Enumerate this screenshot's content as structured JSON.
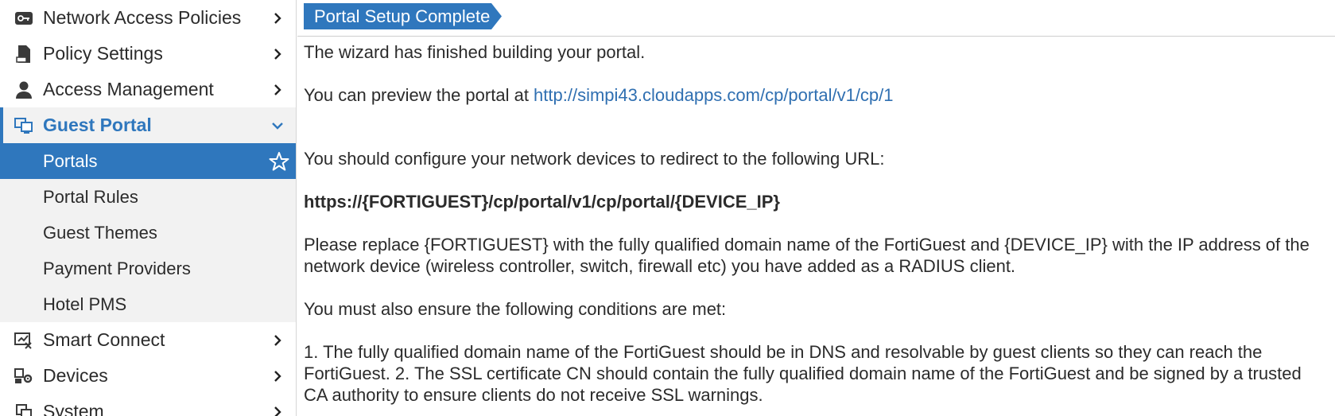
{
  "sidebar": {
    "items": [
      {
        "label": "Network Access Policies",
        "icon": "key-card-icon"
      },
      {
        "label": "Policy Settings",
        "icon": "document-stamp-icon"
      },
      {
        "label": "Access Management",
        "icon": "user-icon"
      },
      {
        "label": "Guest Portal",
        "icon": "monitor-portal-icon",
        "expanded": true
      },
      {
        "label": "Smart Connect",
        "icon": "smart-connect-icon"
      },
      {
        "label": "Devices",
        "icon": "devices-gear-icon"
      },
      {
        "label": "System",
        "icon": "system-icon"
      }
    ],
    "guest_portal_subitems": [
      {
        "label": "Portals",
        "active": true
      },
      {
        "label": "Portal Rules"
      },
      {
        "label": "Guest Themes"
      },
      {
        "label": "Payment Providers"
      },
      {
        "label": "Hotel PMS"
      }
    ]
  },
  "main": {
    "banner_title": "Portal Setup Complete",
    "wizard_text": "The wizard has finished building your portal.",
    "preview_prefix": "You can preview the portal at ",
    "preview_url": "http://simpi43.cloudapps.com/cp/portal/v1/cp/1",
    "configure_text": "You should configure your network devices to redirect to the following URL:",
    "redirect_url": "https://{FORTIGUEST}/cp/portal/v1/cp/portal/{DEVICE_IP}",
    "replace_text": "Please replace {FORTIGUEST} with the fully qualified domain name of the FortiGuest and {DEVICE_IP} with the IP address of the network device (wireless controller, switch, firewall etc) you have added as a RADIUS client.",
    "ensure_text": "You must also ensure the following conditions are met:",
    "conditions_text": "1. The fully qualified domain name of the FortiGuest should be in DNS and resolvable by guest clients so they can reach the FortiGuest. 2. The SSL certificate CN should contain the fully qualified domain name of the FortiGuest and be signed by a trusted CA authority to ensure clients do not receive SSL warnings."
  },
  "colors": {
    "accent": "#2f77bd",
    "link": "#2f6fb1",
    "subnav_bg": "#f2f2f2"
  }
}
